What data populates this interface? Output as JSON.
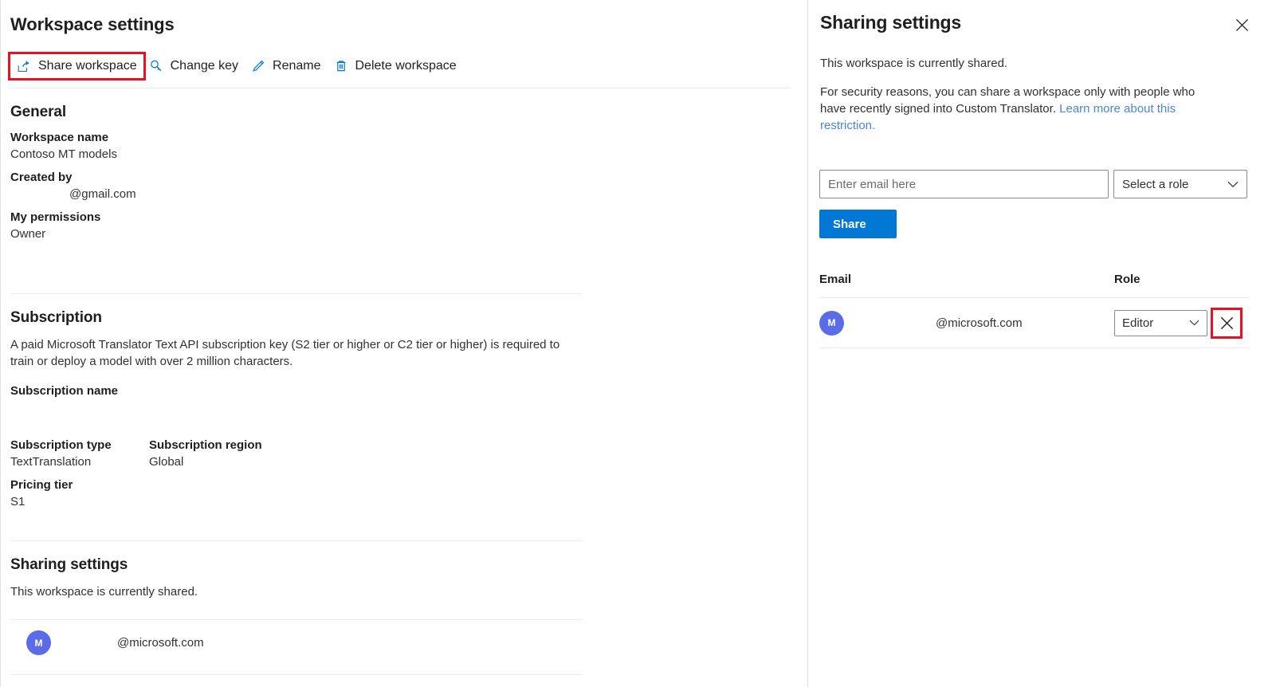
{
  "left": {
    "title": "Workspace settings",
    "toolbar": [
      {
        "label": "Share workspace",
        "icon": "share-icon",
        "highlighted": true
      },
      {
        "label": "Change key",
        "icon": "key-icon",
        "highlighted": false
      },
      {
        "label": "Rename",
        "icon": "pencil-icon",
        "highlighted": false
      },
      {
        "label": "Delete workspace",
        "icon": "trash-icon",
        "highlighted": false
      }
    ],
    "general": {
      "heading": "General",
      "workspace_name_label": "Workspace name",
      "workspace_name_value": "Contoso MT models",
      "created_by_label": "Created by",
      "created_by_value": "@gmail.com",
      "permissions_label": "My permissions",
      "permissions_value": "Owner"
    },
    "subscription": {
      "heading": "Subscription",
      "description": "A paid Microsoft Translator Text API subscription key (S2 tier or higher or C2 tier or higher) is required to train or deploy a model with over 2 million characters.",
      "name_label": "Subscription name",
      "name_value": "",
      "type_label": "Subscription type",
      "type_value": "TextTranslation",
      "region_label": "Subscription region",
      "region_value": "Global",
      "pricing_label": "Pricing tier",
      "pricing_value": "S1"
    },
    "sharing": {
      "heading": "Sharing settings",
      "status": "This workspace is currently shared.",
      "member": {
        "initial": "M",
        "email": "@microsoft.com"
      }
    }
  },
  "right": {
    "title": "Sharing settings",
    "close_icon": "close-icon",
    "lead": "This workspace is currently shared.",
    "note_before": "For security reasons, you can share a workspace only with people who have recently signed into Custom Translator. ",
    "note_link": "Learn more about this restriction.",
    "email_placeholder": "Enter email here",
    "email_value": "",
    "role_placeholder": "Select a role",
    "share_label": "Share",
    "table": {
      "headers": {
        "email": "Email",
        "role": "Role"
      },
      "rows": [
        {
          "initial": "M",
          "email": "@microsoft.com",
          "role": "Editor",
          "delete_icon": "close-icon"
        }
      ]
    }
  },
  "colors": {
    "accent": "#0078d4",
    "highlight": "#e81123",
    "avatar": "#5b6ce8",
    "link": "#4a86d8"
  }
}
